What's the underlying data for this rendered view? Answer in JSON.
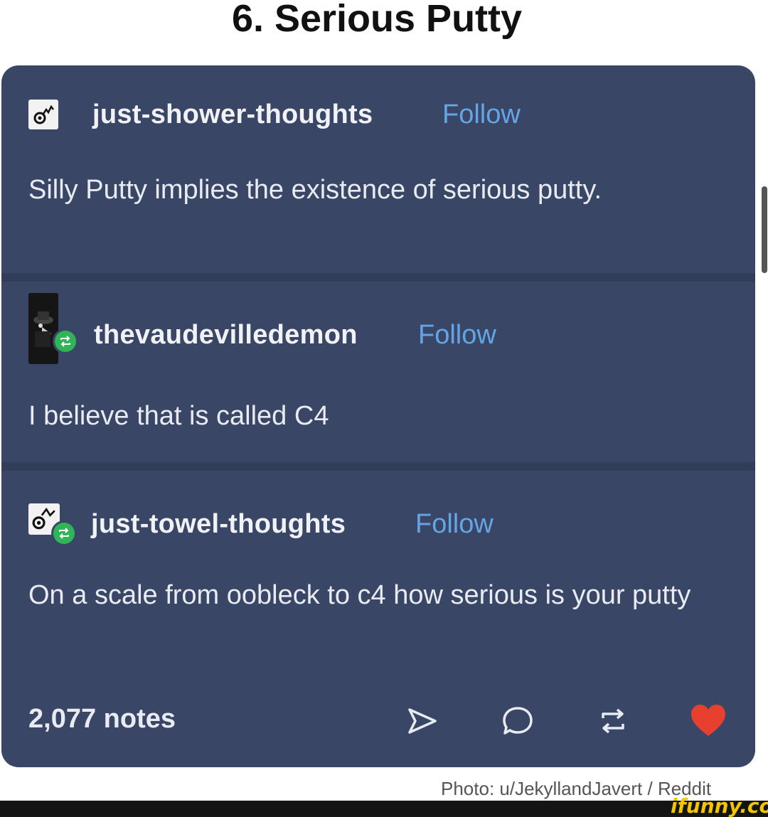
{
  "page": {
    "title": "6. Serious Putty"
  },
  "posts": [
    {
      "username": "just-shower-thoughts",
      "follow_label": "Follow",
      "text": "Silly Putty implies the existence of serious putty.",
      "avatar_icon": "sprinkler-head-icon"
    },
    {
      "username": "thevaudevilledemon",
      "follow_label": "Follow",
      "text": "I believe that is called C4",
      "avatar_icon": "plague-doctor-avatar-icon",
      "reblogged": true
    },
    {
      "username": "just-towel-thoughts",
      "follow_label": "Follow",
      "text": "On a scale from oobleck to c4 how serious is your putty",
      "avatar_icon": "sprinkler-head-icon",
      "reblogged": true
    }
  ],
  "footer": {
    "notes": "2,077 notes",
    "actions": [
      "share-icon",
      "reply-icon",
      "reblog-icon",
      "like-heart-icon"
    ]
  },
  "credit": "Photo: u/JekyllandJavert / Reddit",
  "watermark": "ifunny.co",
  "colors": {
    "card_bg": "#3a4665",
    "follow": "#64a5e6",
    "reblog_badge": "#2fb457",
    "heart": "#e8402f"
  }
}
